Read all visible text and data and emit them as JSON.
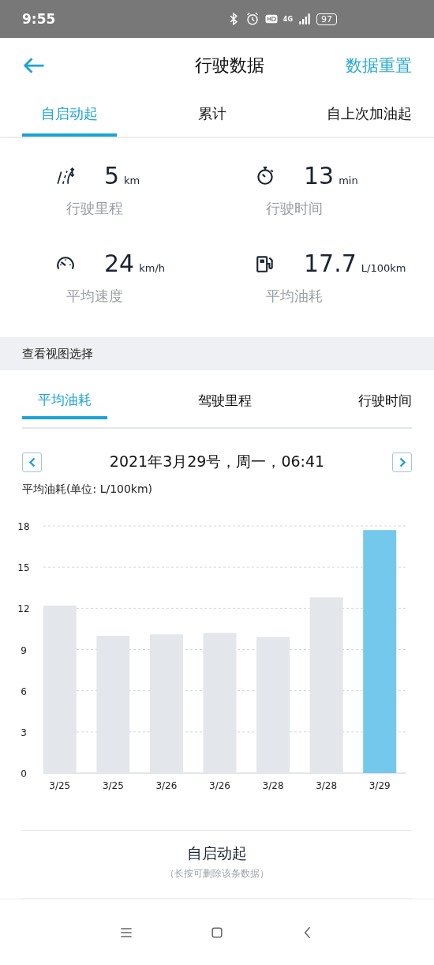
{
  "status_bar": {
    "time": "9:55",
    "battery": "97",
    "network": "4G"
  },
  "header": {
    "title": "行驶数据",
    "action": "数据重置"
  },
  "tabs": [
    {
      "label": "自启动起",
      "selected": true
    },
    {
      "label": "累计",
      "selected": false
    },
    {
      "label": "自上次加油起",
      "selected": false
    }
  ],
  "stats": [
    {
      "kind": "distance",
      "value": "5",
      "unit": "km",
      "label": "行驶里程"
    },
    {
      "kind": "time",
      "value": "13",
      "unit": "min",
      "label": "行驶时间"
    },
    {
      "kind": "speed",
      "value": "24",
      "unit": "km/h",
      "label": "平均速度"
    },
    {
      "kind": "fuel",
      "value": "17.7",
      "unit": "L/100km",
      "label": "平均油耗"
    }
  ],
  "section_title": "查看视图选择",
  "view_tabs": [
    {
      "label": "平均油耗",
      "selected": true
    },
    {
      "label": "驾驶里程",
      "selected": false
    },
    {
      "label": "行驶时间",
      "selected": false
    }
  ],
  "date": "2021年3月29号，周一，06:41",
  "chart_data": {
    "type": "bar",
    "ylabel": "平均油耗(单位: L/100km)",
    "categories": [
      "3/25",
      "3/25",
      "3/26",
      "3/26",
      "3/28",
      "3/28",
      "3/29"
    ],
    "grid": true,
    "ylim": [
      0,
      18
    ],
    "yticks": [
      0,
      3,
      6,
      9,
      12,
      15,
      18
    ],
    "series": [
      {
        "color": "#e3e6ea",
        "values": [
          12.2,
          10.0,
          10.1,
          10.2,
          9.9,
          12.8,
          null
        ]
      },
      {
        "color": "#74c8ec",
        "values": [
          null,
          null,
          null,
          null,
          null,
          null,
          17.7
        ]
      }
    ]
  },
  "record": {
    "title": "自启动起",
    "hint": "（长按可删除该条数据）"
  }
}
